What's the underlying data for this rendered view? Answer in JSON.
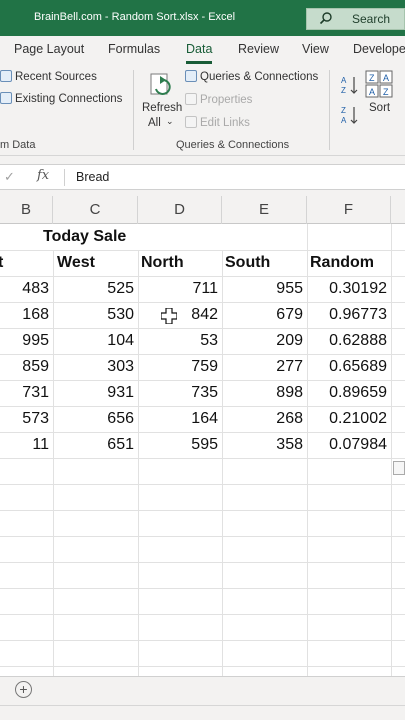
{
  "titlebar": {
    "title": "BrainBell.com - Random Sort.xlsx  -  Excel",
    "search_label": "Search"
  },
  "tabs": [
    "Page Layout",
    "Formulas",
    "Data",
    "Review",
    "View",
    "Develope"
  ],
  "active_tab": "Data",
  "ribbon": {
    "get_data": {
      "recent_sources": "Recent Sources",
      "existing_connections": "Existing Connections",
      "group_label": "m Data"
    },
    "queries": {
      "refresh_all_line1": "Refresh",
      "refresh_all_line2": "All",
      "queries_connections": "Queries & Connections",
      "properties": "Properties",
      "edit_links": "Edit Links",
      "group_label": "Queries & Connections"
    },
    "sort": {
      "sort_label": "Sort"
    }
  },
  "formula_bar": {
    "fx": "fx",
    "value": "Bread"
  },
  "columns": [
    "B",
    "C",
    "D",
    "E",
    "F"
  ],
  "sheet": {
    "title": "Today Sale",
    "headers": [
      "t",
      "West",
      "North",
      "South",
      "Random"
    ],
    "rows": [
      [
        "483",
        "525",
        "711",
        "955",
        "0.30192"
      ],
      [
        "168",
        "530",
        "842",
        "679",
        "0.96773"
      ],
      [
        "995",
        "104",
        "53",
        "209",
        "0.62888"
      ],
      [
        "859",
        "303",
        "759",
        "277",
        "0.65689"
      ],
      [
        "731",
        "931",
        "735",
        "898",
        "0.89659"
      ],
      [
        "573",
        "656",
        "164",
        "268",
        "0.21002"
      ],
      [
        "11",
        "651",
        "595",
        "358",
        "0.07984"
      ]
    ]
  },
  "bottom": {
    "add_sheet": "+"
  },
  "colors": {
    "accent": "#217346",
    "tab_active": "#185c37"
  }
}
